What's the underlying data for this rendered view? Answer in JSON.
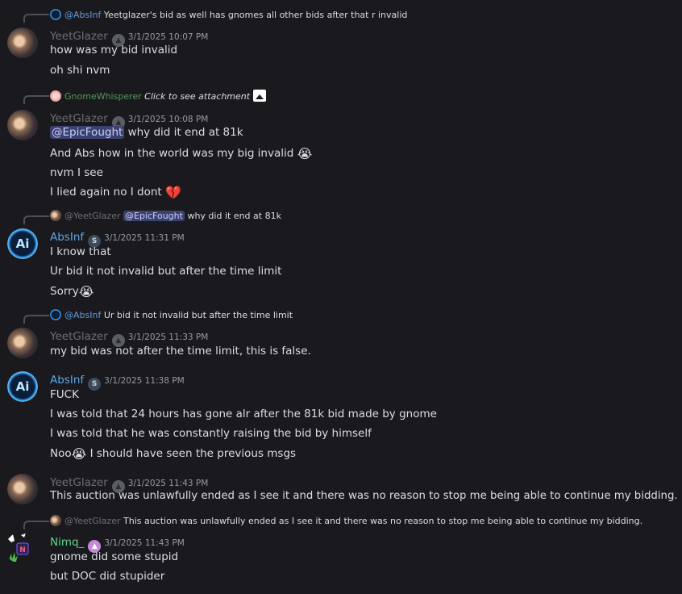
{
  "messages": {
    "m1": {
      "reply": {
        "name": "@AbsInf",
        "text": "Yeetglazer's bid as well has gnomes all other bids after that r invalid"
      },
      "author": "YeetGlazer",
      "timestamp": "3/1/2025 10:07 PM",
      "lines": [
        "how was my bid invalid",
        "oh shi nvm"
      ]
    },
    "m2": {
      "reply": {
        "name": "GnomeWhisperer",
        "text": "Click to see attachment"
      },
      "author": "YeetGlazer",
      "timestamp": "3/1/2025 10:08 PM",
      "mention": "@EpicFought",
      "line1_rest": " why did it end at 81k",
      "line2": "And Abs how in the world was my big invalid",
      "line3": "nvm I see",
      "line4": "I lied again no I dont"
    },
    "m3": {
      "reply": {
        "name": "@YeetGlazer",
        "mention": "@EpicFought",
        "text": " why did it end at 81k"
      },
      "author": "AbsInf",
      "badge": "S",
      "timestamp": "3/1/2025 11:31 PM",
      "lines": [
        "I know that",
        "Ur bid it not invalid but after the time limit"
      ],
      "line3": "Sorry"
    },
    "m4": {
      "reply": {
        "name": "@AbsInf",
        "text": "Ur bid it not invalid but after the time limit"
      },
      "author": "YeetGlazer",
      "timestamp": "3/1/2025 11:33 PM",
      "lines": [
        "my bid was not after the time limit, this is false."
      ]
    },
    "m5": {
      "author": "AbsInf",
      "badge": "S",
      "timestamp": "3/1/2025 11:38 PM",
      "lines": [
        "FUCK",
        "I was told that 24 hours has gone alr after the 81k bid made by gnome",
        "I was told that he was constantly raising the bid by himself"
      ],
      "line4_pre": "Noo",
      "line4_post": " I should have seen the previous msgs"
    },
    "m6": {
      "author": "YeetGlazer",
      "timestamp": "3/1/2025 11:43 PM",
      "lines": [
        "This auction was unlawfully ended as I see it and there was no reason to stop me being able to continue my bidding."
      ]
    },
    "m7": {
      "reply": {
        "name": "@YeetGlazer",
        "text": "This auction was unlawfully ended as I see it and there was no reason to stop me being able to continue my bidding."
      },
      "author": "Nimq_",
      "timestamp": "3/1/2025 11:43 PM",
      "lines": [
        "gnome did some stupid",
        "but DOC did stupider"
      ]
    }
  },
  "emojis": {
    "crying": "😭",
    "broken_heart": "💔"
  },
  "colors": {
    "yeetglazer": "#6d6f74",
    "absinf": "#5aa7e6",
    "gnomewhisperer": "#4f9a5b",
    "nimq": "#5fd38d",
    "background": "#1a1a1e"
  }
}
